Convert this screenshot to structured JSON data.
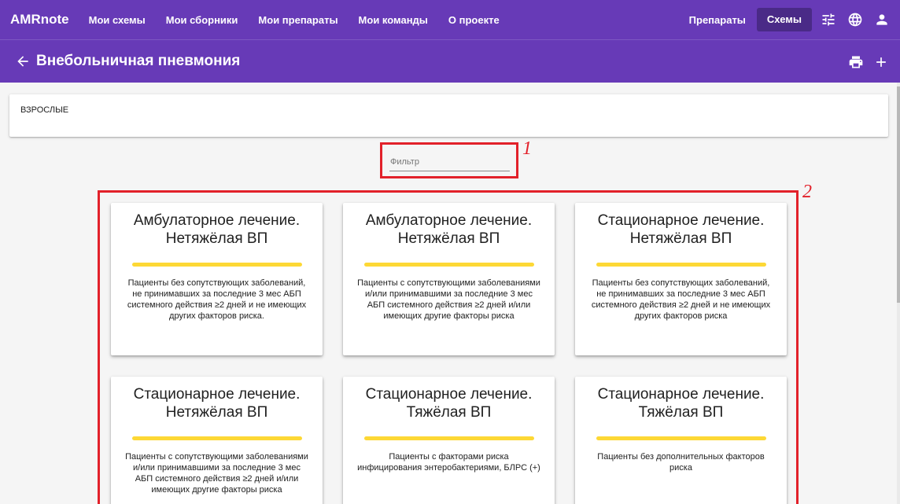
{
  "header": {
    "brand": "AMRnote",
    "nav": [
      "Мои схемы",
      "Мои сборники",
      "Мои препараты",
      "Мои команды",
      "О проекте"
    ],
    "right_links": [
      "Препараты",
      "Схемы"
    ],
    "icons": [
      "tune-icon",
      "globe-icon",
      "user-icon"
    ]
  },
  "subheader": {
    "title": "Внебольничная пневмония",
    "icons": [
      "back-arrow-icon",
      "print-icon",
      "add-icon"
    ]
  },
  "section": {
    "label": "ВЗРОСЛЫЕ"
  },
  "filter": {
    "placeholder": "Фильтр",
    "value": ""
  },
  "annotations": [
    "1",
    "2"
  ],
  "cards": [
    {
      "title": "Амбулаторное лечение. Нетяжёлая ВП",
      "description": "Пациенты без сопутствующих заболеваний, не принимавших за последние 3 мес АБП системного действия ≥2 дней и не имеющих других факторов риска."
    },
    {
      "title": "Амбулаторное лечение. Нетяжёлая ВП",
      "description": "Пациенты с сопутствующими заболеваниями и/или принимавшими за последние 3 мес АБП системного действия ≥2 дней и/или имеющих другие факторы риска"
    },
    {
      "title": "Стационарное лечение. Нетяжёлая ВП",
      "description": "Пациенты без сопутствующих заболеваний, не принимавших за последние 3 мес АБП системного действия ≥2 дней и не имеющих других факторов риска"
    },
    {
      "title": "Стационарное лечение. Нетяжёлая ВП",
      "description": "Пациенты с сопутствующими заболеваниями и/или принимавшими за последние 3 мес АБП системного действия ≥2 дней и/или имеющих другие факторы риска"
    },
    {
      "title": "Стационарное лечение. Тяжёлая ВП",
      "description": "Пациенты с факторами риска инфицирования энтеробактериями, БЛРС (+)"
    },
    {
      "title": "Стационарное лечение. Тяжёлая ВП",
      "description": "Пациенты без дополнительных факторов риска"
    }
  ],
  "colors": {
    "primary": "#673ab7",
    "active_tab": "#4a2a87",
    "accent_bar": "#fdd835",
    "annotation": "#e2212a"
  }
}
